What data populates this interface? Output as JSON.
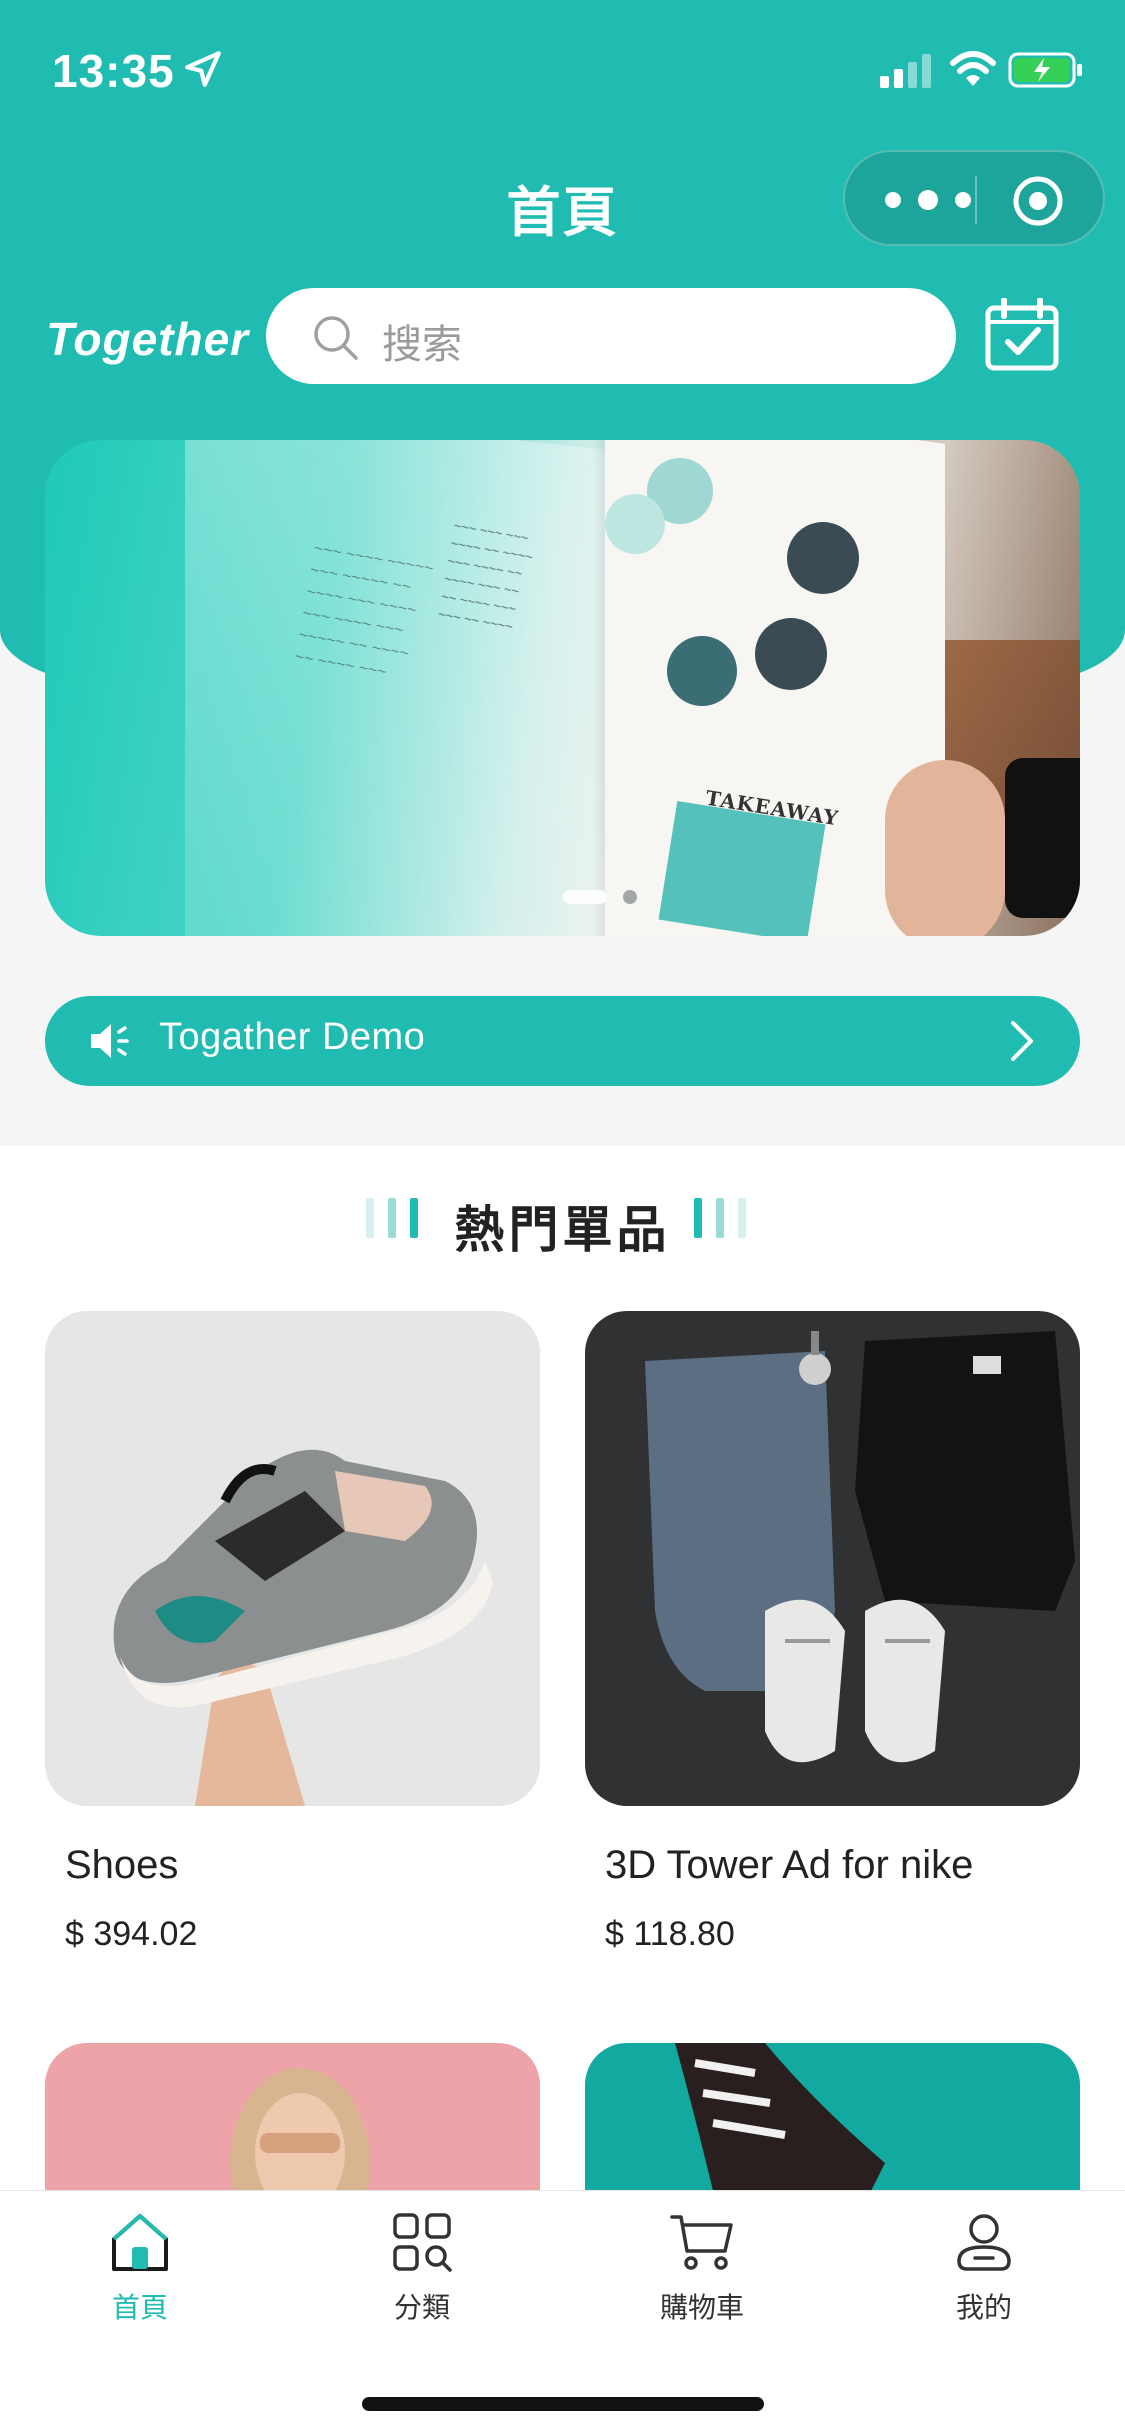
{
  "status_bar": {
    "time": "13:35"
  },
  "nav": {
    "title": "首頁"
  },
  "header": {
    "brand": "Together",
    "search_placeholder": "搜索"
  },
  "banner": {
    "slide_count": 2,
    "active_slide": 1,
    "takeaway_text": "TAKEAWAY"
  },
  "notice": {
    "text": "Togather Demo"
  },
  "section": {
    "title": "熱門單品"
  },
  "products": [
    {
      "name": "Shoes",
      "price": "$ 394.02"
    },
    {
      "name": "3D Tower Ad for nike",
      "price": "$ 118.80"
    },
    {
      "name": "",
      "price": ""
    },
    {
      "name": "",
      "price": ""
    }
  ],
  "tabbar": {
    "items": [
      {
        "label": "首頁",
        "icon": "home-icon",
        "active": true
      },
      {
        "label": "分類",
        "icon": "category-icon",
        "active": false
      },
      {
        "label": "購物車",
        "icon": "cart-icon",
        "active": false
      },
      {
        "label": "我的",
        "icon": "profile-icon",
        "active": false
      }
    ]
  },
  "colors": {
    "accent": "#21bcb1",
    "text": "#222222",
    "background": "#f5f5f5"
  }
}
